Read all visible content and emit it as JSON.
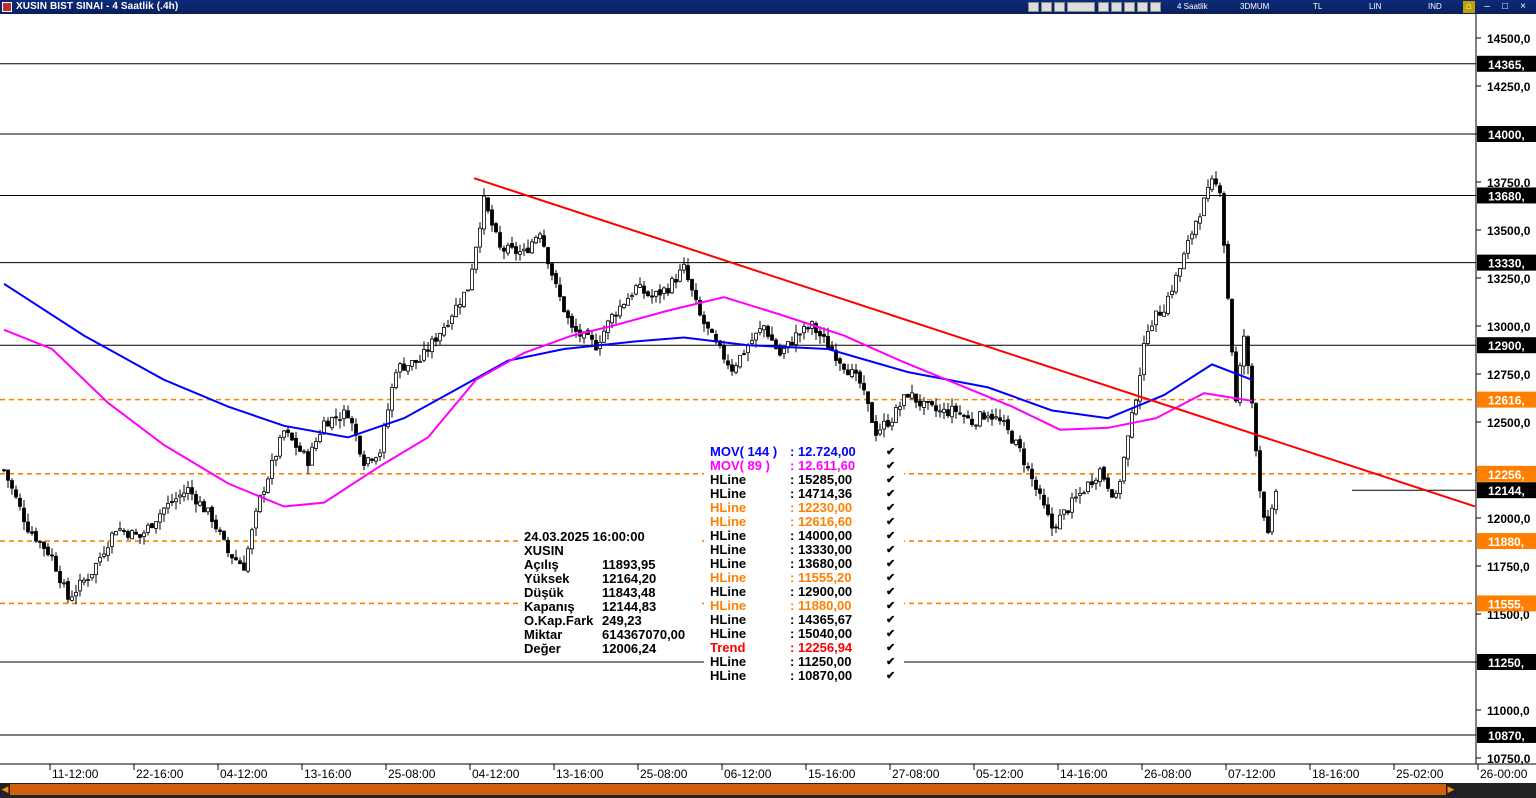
{
  "window": {
    "title": "XUSIN BIST SINAI - 4 Saatlik (.4h)",
    "toolbar_labels": [
      "4 Saatlik",
      "3DMUM",
      "TL",
      "LIN",
      "IND"
    ]
  },
  "colors": {
    "background": "#ffffff",
    "candle": "#000000",
    "trend": "#ff0000",
    "mov144": "#0000ff",
    "mov89": "#ff00ff",
    "hline_black": "#000000",
    "hline_orange": "#ff8000"
  },
  "info_panel": {
    "datetime": "24.03.2025  16:00:00",
    "symbol": "XUSIN",
    "rows": [
      {
        "label": "Açılış",
        "value": "11893,95"
      },
      {
        "label": "Yüksek",
        "value": "12164,20"
      },
      {
        "label": "Düşük",
        "value": "11843,48"
      },
      {
        "label": "Kapanış",
        "value": "12144,83"
      },
      {
        "label": "O.Kap.Fark",
        "value": "249,23"
      },
      {
        "label": "Miktar",
        "value": "614367070,00"
      },
      {
        "label": "Değer",
        "value": "12006,24"
      }
    ]
  },
  "legend": [
    {
      "label": "MOV( 144 )",
      "value": ": 12.724,00",
      "color": "#0000ff"
    },
    {
      "label": "MOV( 89 )",
      "value": ": 12.611,60",
      "color": "#ff00ff"
    },
    {
      "label": "HLine",
      "value": ": 15285,00",
      "color": "#000000"
    },
    {
      "label": "HLine",
      "value": ": 14714,36",
      "color": "#000000"
    },
    {
      "label": "HLine",
      "value": ": 12230,00",
      "color": "#ff8000"
    },
    {
      "label": "HLine",
      "value": ": 12616,60",
      "color": "#ff8000"
    },
    {
      "label": "HLine",
      "value": ": 14000,00",
      "color": "#000000"
    },
    {
      "label": "HLine",
      "value": ": 13330,00",
      "color": "#000000"
    },
    {
      "label": "HLine",
      "value": ": 13680,00",
      "color": "#000000"
    },
    {
      "label": "HLine",
      "value": ": 11555,20",
      "color": "#ff8000"
    },
    {
      "label": "HLine",
      "value": ": 12900,00",
      "color": "#000000"
    },
    {
      "label": "HLine",
      "value": ": 11880,00",
      "color": "#ff8000"
    },
    {
      "label": "HLine",
      "value": ": 14365,67",
      "color": "#000000"
    },
    {
      "label": "HLine",
      "value": ": 15040,00",
      "color": "#000000"
    },
    {
      "label": "Trend",
      "value": ": 12256,94",
      "color": "#ff0000"
    },
    {
      "label": "HLine",
      "value": ": 11250,00",
      "color": "#000000"
    },
    {
      "label": "HLine",
      "value": ": 10870,00",
      "color": "#000000"
    }
  ],
  "chart_data": {
    "type": "candlestick",
    "ylim": [
      10700,
      14600
    ],
    "yticks": [
      10750,
      11000,
      11250,
      11500,
      11750,
      12000,
      12250,
      12500,
      12750,
      13000,
      13250,
      13500,
      13750,
      14000,
      14250,
      14500
    ],
    "ytick_labels": [
      "10750,0",
      "11000,0",
      "11250,0",
      "11500,0",
      "11750,0",
      "12000,0",
      "12250,0",
      "12500,0",
      "12750,0",
      "13000,0",
      "13250,0",
      "13500,0",
      "13750,0",
      "14000,0",
      "14250,0",
      "14500,0"
    ],
    "xticks": [
      "11-12:00",
      "22-16:00",
      "04-12:00",
      "13-16:00",
      "25-08:00",
      "04-12:00",
      "13-16:00",
      "25-08:00",
      "06-12:00",
      "15-16:00",
      "27-08:00",
      "05-12:00",
      "14-16:00",
      "26-08:00",
      "07-12:00",
      "18-16:00",
      "25-02:00",
      "26-00:00"
    ],
    "bars_count": 340,
    "hlines": [
      {
        "value": 14365.67,
        "label": "14365,",
        "style": "solid",
        "color": "#000000"
      },
      {
        "value": 14000,
        "label": "14000,",
        "style": "solid",
        "color": "#000000"
      },
      {
        "value": 13680,
        "label": "13680,",
        "style": "solid",
        "color": "#000000"
      },
      {
        "value": 13330,
        "label": "13330,",
        "style": "solid",
        "color": "#000000"
      },
      {
        "value": 12900,
        "label": "12900,",
        "style": "solid",
        "color": "#000000"
      },
      {
        "value": 12616.6,
        "label": "12616,",
        "style": "dashed",
        "color": "#ff8000"
      },
      {
        "value": 12230,
        "label": "12256,",
        "style": "dashed",
        "color": "#ff8000"
      },
      {
        "value": 11880,
        "label": "11880,",
        "style": "dashed",
        "color": "#ff8000"
      },
      {
        "value": 11555.2,
        "label": "11555,",
        "style": "dashed",
        "color": "#ff8000"
      },
      {
        "value": 11250,
        "label": "11250,",
        "style": "solid",
        "color": "#000000"
      },
      {
        "value": 10870,
        "label": "10870,",
        "style": "solid",
        "color": "#000000"
      }
    ],
    "last_price_label": "12144,",
    "last_price": 12144.83,
    "trend_line": {
      "start": {
        "bar": 110,
        "value": 13770
      },
      "end": {
        "bar": 340,
        "value": 12060
      }
    },
    "close_path": [
      [
        0,
        12250
      ],
      [
        6,
        11950
      ],
      [
        12,
        11800
      ],
      [
        16,
        11580
      ],
      [
        22,
        11720
      ],
      [
        28,
        11950
      ],
      [
        34,
        11900
      ],
      [
        40,
        12050
      ],
      [
        46,
        12150
      ],
      [
        52,
        12000
      ],
      [
        56,
        11820
      ],
      [
        60,
        11750
      ],
      [
        64,
        12100
      ],
      [
        70,
        12450
      ],
      [
        76,
        12300
      ],
      [
        80,
        12500
      ],
      [
        86,
        12550
      ],
      [
        90,
        12300
      ],
      [
        94,
        12350
      ],
      [
        98,
        12780
      ],
      [
        104,
        12820
      ],
      [
        110,
        13000
      ],
      [
        116,
        13200
      ],
      [
        120,
        13650
      ],
      [
        124,
        13400
      ],
      [
        130,
        13380
      ],
      [
        134,
        13500
      ],
      [
        138,
        13200
      ],
      [
        142,
        12980
      ],
      [
        148,
        12900
      ],
      [
        152,
        13050
      ],
      [
        158,
        13200
      ],
      [
        162,
        13150
      ],
      [
        166,
        13200
      ],
      [
        170,
        13300
      ],
      [
        174,
        13050
      ],
      [
        178,
        12900
      ],
      [
        182,
        12780
      ],
      [
        186,
        12900
      ],
      [
        190,
        13000
      ],
      [
        194,
        12850
      ],
      [
        198,
        12950
      ],
      [
        202,
        13000
      ],
      [
        206,
        12900
      ],
      [
        210,
        12800
      ],
      [
        214,
        12700
      ],
      [
        218,
        12450
      ],
      [
        222,
        12520
      ],
      [
        226,
        12650
      ],
      [
        230,
        12580
      ],
      [
        234,
        12550
      ],
      [
        238,
        12560
      ],
      [
        242,
        12500
      ],
      [
        246,
        12550
      ],
      [
        250,
        12480
      ],
      [
        254,
        12350
      ],
      [
        258,
        12150
      ],
      [
        262,
        11950
      ],
      [
        266,
        12050
      ],
      [
        270,
        12150
      ],
      [
        274,
        12250
      ],
      [
        278,
        12100
      ],
      [
        282,
        12520
      ],
      [
        286,
        13000
      ],
      [
        290,
        13100
      ],
      [
        294,
        13300
      ],
      [
        298,
        13550
      ],
      [
        302,
        13740
      ],
      [
        304,
        13720
      ],
      [
        306,
        13150
      ],
      [
        308,
        12600
      ],
      [
        310,
        12950
      ],
      [
        312,
        12600
      ],
      [
        314,
        12150
      ],
      [
        316,
        11900
      ],
      [
        318,
        12144
      ]
    ],
    "mov144_path": [
      [
        0,
        13220
      ],
      [
        20,
        12950
      ],
      [
        40,
        12720
      ],
      [
        56,
        12580
      ],
      [
        70,
        12480
      ],
      [
        86,
        12420
      ],
      [
        100,
        12520
      ],
      [
        114,
        12680
      ],
      [
        126,
        12820
      ],
      [
        140,
        12880
      ],
      [
        158,
        12920
      ],
      [
        170,
        12940
      ],
      [
        186,
        12900
      ],
      [
        206,
        12880
      ],
      [
        226,
        12760
      ],
      [
        246,
        12680
      ],
      [
        262,
        12560
      ],
      [
        276,
        12520
      ],
      [
        290,
        12640
      ],
      [
        302,
        12800
      ],
      [
        312,
        12720
      ]
    ],
    "mov89_path": [
      [
        0,
        12980
      ],
      [
        12,
        12880
      ],
      [
        26,
        12600
      ],
      [
        40,
        12380
      ],
      [
        56,
        12180
      ],
      [
        70,
        12060
      ],
      [
        80,
        12080
      ],
      [
        94,
        12270
      ],
      [
        106,
        12420
      ],
      [
        118,
        12720
      ],
      [
        130,
        12860
      ],
      [
        142,
        12950
      ],
      [
        152,
        13000
      ],
      [
        166,
        13080
      ],
      [
        180,
        13150
      ],
      [
        194,
        13060
      ],
      [
        210,
        12950
      ],
      [
        224,
        12820
      ],
      [
        238,
        12700
      ],
      [
        252,
        12580
      ],
      [
        264,
        12460
      ],
      [
        276,
        12470
      ],
      [
        288,
        12520
      ],
      [
        300,
        12650
      ],
      [
        312,
        12610
      ]
    ]
  }
}
